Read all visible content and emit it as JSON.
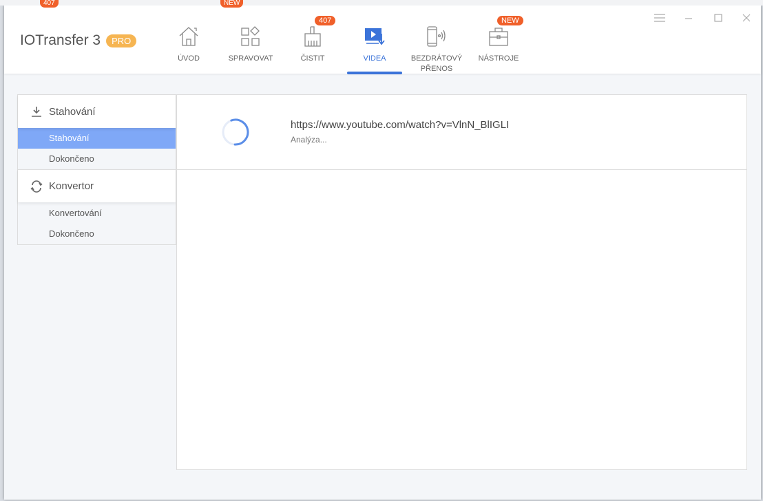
{
  "app": {
    "title": "IOTransfer 3",
    "edition": "PRO"
  },
  "behind": {
    "badges": [
      "407",
      "NEW"
    ]
  },
  "nav": [
    {
      "label": "ÚVOD",
      "icon": "home-icon"
    },
    {
      "label": "SPRAVOVAT",
      "icon": "manage-icon"
    },
    {
      "label": "ČISTIT",
      "icon": "brush-icon",
      "badge": "407"
    },
    {
      "label": "VIDEA",
      "icon": "video-download-icon",
      "active": true
    },
    {
      "label": "BEZDRÁTOVÝ PŘENOS",
      "icon": "wireless-phone-icon"
    },
    {
      "label": "NÁSTROJE",
      "icon": "toolbox-icon",
      "badge": "NEW"
    }
  ],
  "sidebar": {
    "download": {
      "title": "Stahování",
      "items": [
        "Stahování",
        "Dokončeno"
      ],
      "active": 0
    },
    "converter": {
      "title": "Konvertor",
      "items": [
        "Konvertování",
        "Dokončeno"
      ]
    }
  },
  "tasks": [
    {
      "url": "https://www.youtube.com/watch?v=VlnN_BlIGLI",
      "status": "Analýza..."
    }
  ],
  "colors": {
    "accent": "#3b73d9",
    "badge": "#f0602a",
    "pro": "#f6b552",
    "selected": "#7fa8f7"
  }
}
